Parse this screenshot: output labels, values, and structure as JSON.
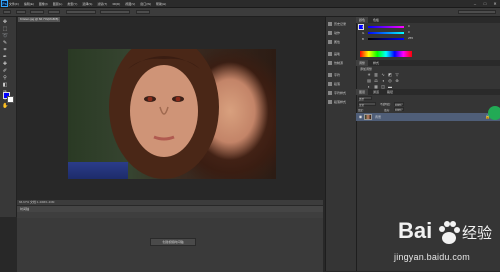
{
  "app": {
    "logo_text": "Ps",
    "menu": [
      "文件(F)",
      "编辑(E)",
      "图像(I)",
      "图层(L)",
      "类型(Y)",
      "选择(S)",
      "滤镜(T)",
      "3D(D)",
      "视图(V)",
      "窗口(W)",
      "帮助(H)"
    ],
    "window_controls": [
      "–",
      "□",
      "✕"
    ]
  },
  "document": {
    "tab_label": "Kristen.jpg @ 66.7%(RGB/8)",
    "status_text": "66.67%    文档:1.43M/1.43M"
  },
  "tools": [
    "move-icon",
    "marquee-icon",
    "lasso-icon",
    "quick-select-icon",
    "crop-icon",
    "eyedropper-icon",
    "healing-icon",
    "brush-icon",
    "stamp-icon",
    "history-brush-icon",
    "eraser-icon",
    "gradient-icon",
    "blur-icon",
    "dodge-icon",
    "pen-icon",
    "type-icon",
    "path-select-icon",
    "shape-icon",
    "hand-icon",
    "zoom-icon"
  ],
  "colors": {
    "foreground": "#0000ff",
    "background": "#ffffff",
    "accent_badge": "#22aa55"
  },
  "timeline": {
    "title": "时间轴",
    "create_button": "创建视频时间轴"
  },
  "dock": [
    {
      "label": "历史记录",
      "icon": "history-icon"
    },
    {
      "label": "动作",
      "icon": "actions-icon"
    },
    {
      "label": "属性",
      "icon": "properties-icon"
    },
    {
      "label": "画笔",
      "icon": "brush-panel-icon"
    },
    {
      "label": "仿制源",
      "icon": "clone-source-icon"
    },
    {
      "label": "字符",
      "icon": "character-icon"
    },
    {
      "label": "段落",
      "icon": "paragraph-icon"
    },
    {
      "label": "字符样式",
      "icon": "char-style-icon"
    },
    {
      "label": "段落样式",
      "icon": "para-style-icon"
    }
  ],
  "color_panel": {
    "tabs": [
      "颜色",
      "色板"
    ],
    "rows": [
      {
        "label": "R",
        "value": "0"
      },
      {
        "label": "G",
        "value": "0"
      },
      {
        "label": "B",
        "value": "255"
      }
    ]
  },
  "adjustments_panel": {
    "tabs": [
      "调整",
      "样式"
    ],
    "title": "添加调整"
  },
  "layers_panel": {
    "tabs": [
      "图层",
      "通道",
      "路径"
    ],
    "kind_label": "类型",
    "blend_mode": "正常",
    "opacity_label": "不透明度:",
    "opacity": "100%",
    "lock_label": "锁定:",
    "fill_label": "填充:",
    "fill": "100%",
    "layer_name": "背景"
  },
  "watermark": {
    "brand": "Bai",
    "brand_suffix": "经验",
    "url": "jingyan.baidu.com"
  }
}
